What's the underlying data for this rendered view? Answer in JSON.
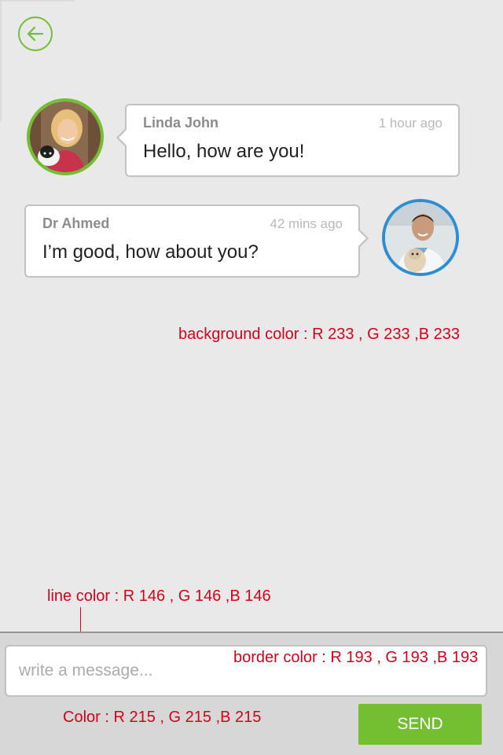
{
  "colors": {
    "accent_green": "#74be32",
    "accent_blue": "#2d8ed3",
    "background": "#e9e9e9",
    "composer_background": "#d7d7d7",
    "divider_line": "#929292",
    "input_border": "#c1c1c1",
    "annotation_red": "#d0021b"
  },
  "header": {
    "back_icon": "arrow-left-icon"
  },
  "messages": [
    {
      "sender": "Linda John",
      "time": "1 hour ago",
      "text": "Hello, how are you!",
      "side": "left",
      "avatar_icon": "user-photo-icon"
    },
    {
      "sender": "Dr Ahmed",
      "time": "42 mins ago",
      "text": "I’m good, how about you?",
      "side": "right",
      "avatar_icon": "doctor-photo-icon"
    }
  ],
  "annotations": {
    "background": "background color : R 233 , G 233 ,B 233",
    "line": "line color : R 146 , G 146 ,B 146",
    "border": "border color : R 193 , G 193 ,B 193",
    "fill": "Color : R 215 , G 215 ,B 215"
  },
  "composer": {
    "placeholder": "write a message...",
    "value": "",
    "send_label": "SEND"
  }
}
